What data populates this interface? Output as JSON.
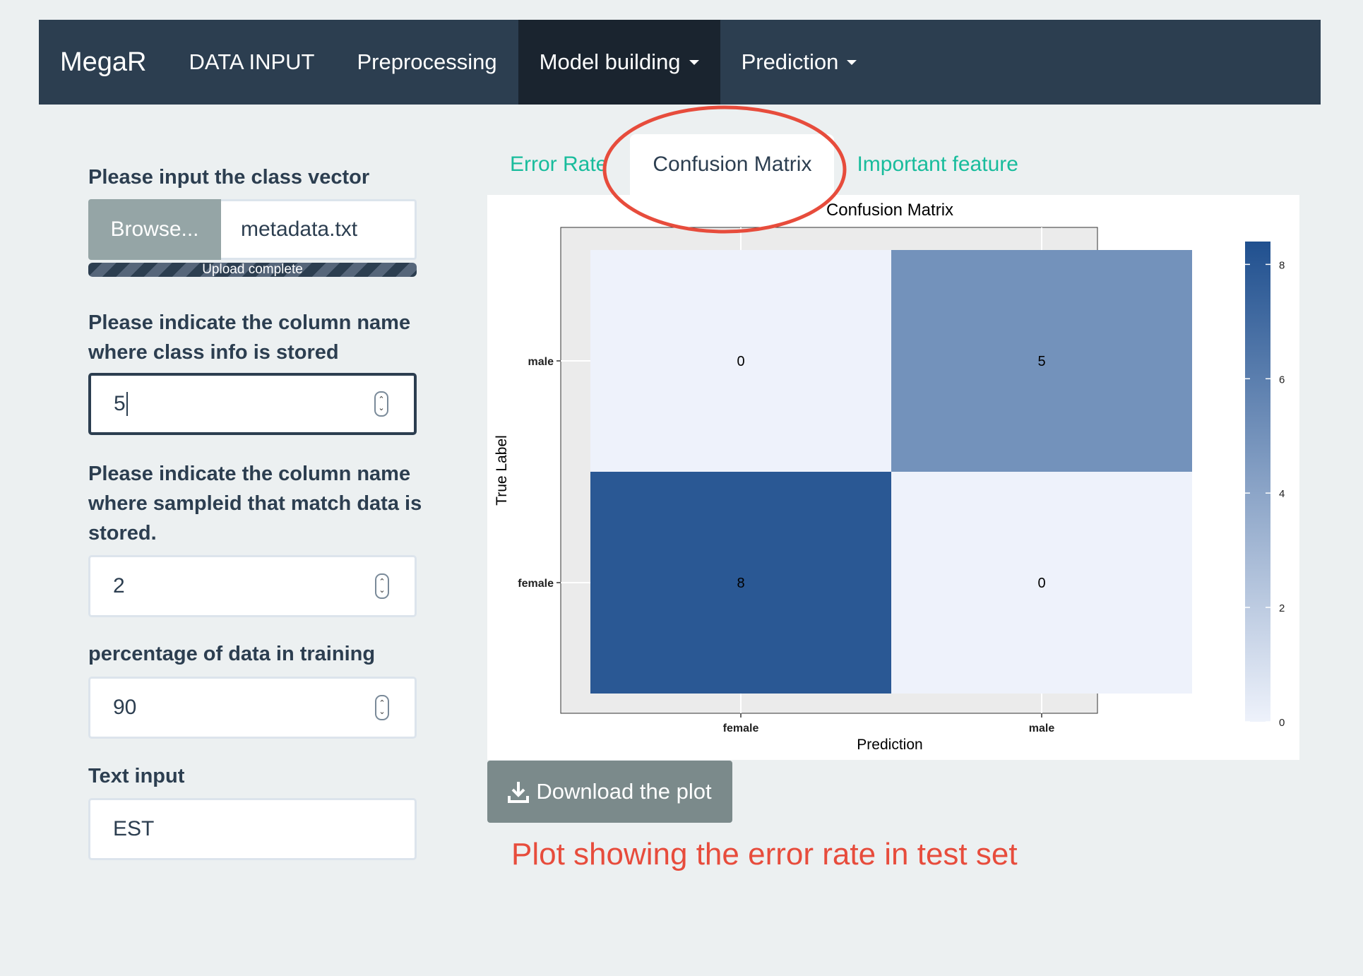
{
  "navbar": {
    "brand": "MegaR",
    "items": [
      {
        "label": "DATA INPUT",
        "dropdown": false
      },
      {
        "label": "Preprocessing",
        "dropdown": false
      },
      {
        "label": "Model building",
        "dropdown": true
      },
      {
        "label": "Prediction",
        "dropdown": true
      }
    ]
  },
  "sidebar": {
    "class_vector_label": "Please input the class vector",
    "browse_label": "Browse...",
    "file_name": "metadata.txt",
    "upload_status": "Upload complete",
    "class_column_label_1": "Please indicate the column name",
    "class_column_label_2": "where class info is stored",
    "class_column_value": "5",
    "sampleid_label_1": "Please indicate the column name",
    "sampleid_label_2": "where sampleid that match data is",
    "sampleid_label_3": "stored.",
    "sampleid_value": "2",
    "training_label": "percentage of data in training",
    "training_value": "90",
    "text_input_label": "Text input",
    "text_input_value": "EST"
  },
  "tabs": [
    "Error Rate",
    "Confusion Matrix",
    "Important feature"
  ],
  "download_label": "Download the plot",
  "caption": "Plot showing the error rate in test set",
  "colors": {
    "navbar": "#2c3e50",
    "tab_link": "#18bc9c",
    "annotation": "#e74c3c",
    "heat_low": "#eef2fb",
    "heat_high": "#20508f"
  },
  "chart_data": {
    "type": "heatmap",
    "title": "Confusion Matrix",
    "xlabel": "Prediction",
    "ylabel": "True Label",
    "x_categories": [
      "female",
      "male"
    ],
    "y_categories": [
      "female",
      "male"
    ],
    "values": [
      [
        8,
        0
      ],
      [
        0,
        5
      ]
    ],
    "legend_ticks": [
      0,
      2,
      4,
      6,
      8
    ],
    "legend_range": [
      0,
      8.4
    ]
  }
}
